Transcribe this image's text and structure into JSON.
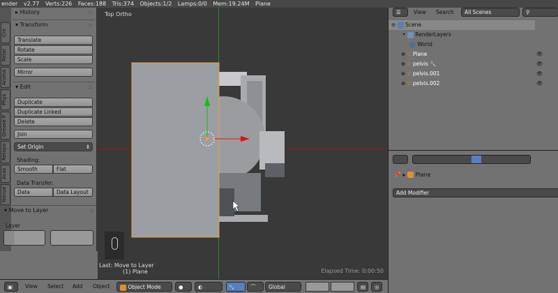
{
  "topbar": {
    "engine": "ender",
    "version": "v2.77",
    "verts": "Verts:226",
    "faces": "Faces:188",
    "tris": "Tris:374",
    "objects": "Objects:1/2",
    "lamps": "Lamps:0/0",
    "mem": "Mem:19.24M",
    "active": "Plane"
  },
  "tabs": [
    "Cre",
    "Relat",
    "Anima",
    "Phys",
    "Grease P",
    "Retopo",
    "Avas",
    "Nonue"
  ],
  "shelf": {
    "history": "History",
    "transform": "Transform",
    "translate": "Translate",
    "rotate": "Rotate",
    "scale": "Scale",
    "mirror": "Mirror",
    "edit": "Edit",
    "duplicate": "Duplicate",
    "duplicate_linked": "Duplicate Linked",
    "delete": "Delete",
    "join": "Join",
    "set_origin": "Set Origin",
    "shading": "Shading:",
    "smooth": "Smooth",
    "flat": "Flat",
    "data_transfer": "Data Transfer:",
    "data": "Data",
    "data_layout": "Data Layout",
    "move_to_layer": "Move to Layer",
    "layer": "Layer"
  },
  "viewport": {
    "view_name": "Top Ortho",
    "last_op": "Last: Move to Layer",
    "object_label": "(1) Plane",
    "elapsed": "Elapsed Time: 0:00:50"
  },
  "bottom": {
    "view": "View",
    "select": "Select",
    "add": "Add",
    "object": "Object",
    "mode": "Object Mode",
    "orientation": "Global"
  },
  "outliner": {
    "view": "View",
    "search": "Search",
    "filter": "All Scenes",
    "items": [
      {
        "name": "Scene"
      },
      {
        "name": "RenderLayers"
      },
      {
        "name": "World"
      },
      {
        "name": "Plane"
      },
      {
        "name": "pelvis"
      },
      {
        "name": "pelvis.001"
      },
      {
        "name": "pelvis.002"
      }
    ]
  },
  "props": {
    "object": "Plane",
    "add_modifier": "Add Modifier"
  },
  "colors": {
    "accent": "#5680c2",
    "selected": "#f0a040",
    "x_axis": "#d01010",
    "y_axis": "#10b010"
  }
}
